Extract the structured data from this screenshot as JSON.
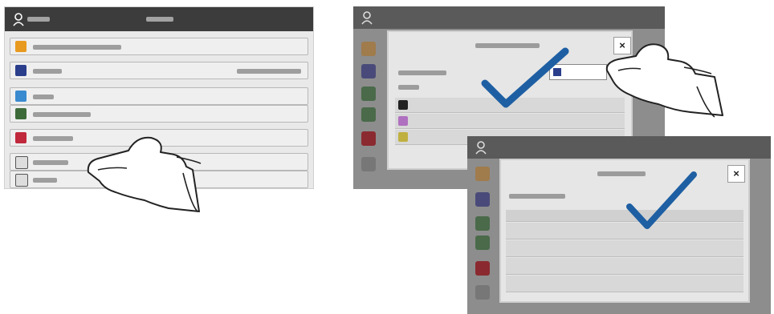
{
  "panel1": {
    "icons": [
      "user-icon",
      "star-icon",
      "book-icon",
      "scan-icon",
      "photo-icon",
      "app-icon",
      "copy-icon",
      "lock-icon"
    ]
  },
  "panel2": {
    "close_label": "×"
  },
  "panel3": {
    "close_label": "×"
  },
  "colors": {
    "check": "#1e5fa3",
    "topbar": "#3c3c3c",
    "dialog": "#e6e6e6"
  }
}
